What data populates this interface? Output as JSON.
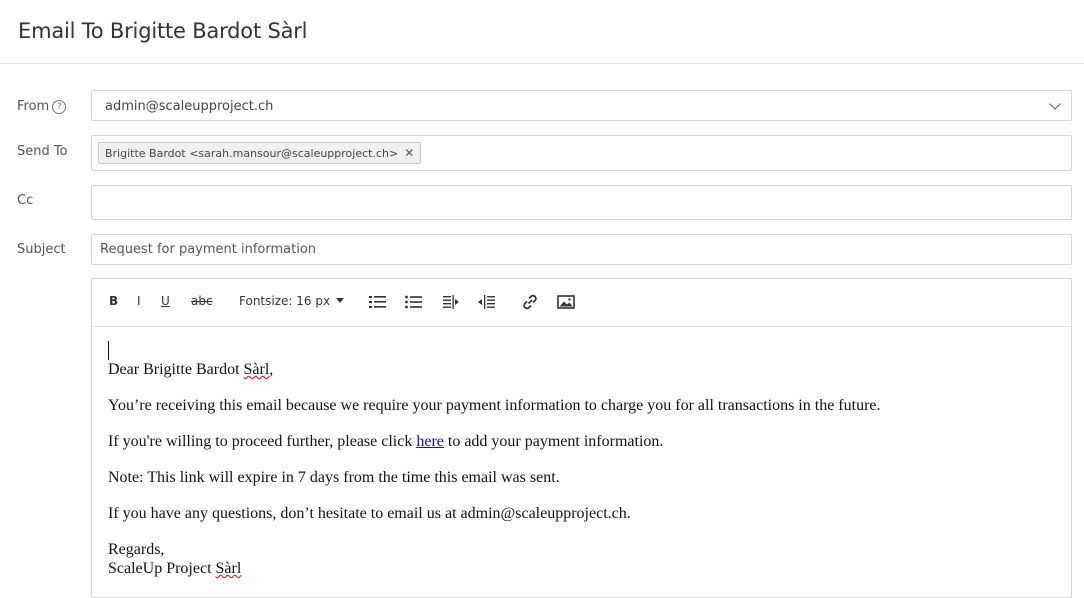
{
  "header": {
    "title": "Email To Brigitte Bardot Sàrl"
  },
  "form": {
    "from_label": "From",
    "from_value": "admin@scaleupproject.ch",
    "send_to_label": "Send To",
    "recipient_chip": "Brigitte Bardot <sarah.mansour@scaleupproject.ch>",
    "cc_label": "Cc",
    "cc_value": "",
    "subject_label": "Subject",
    "subject_value": "Request for payment information"
  },
  "toolbar": {
    "bold": "B",
    "italic": "I",
    "underline": "U",
    "strike": "abc",
    "fontsize": "Fontsize: 16 px",
    "icons": [
      "ordered-list-icon",
      "unordered-list-icon",
      "indent-icon",
      "outdent-icon",
      "link-icon",
      "image-icon"
    ]
  },
  "message": {
    "greeting_prefix": "Dear Brigitte Bardot ",
    "greeting_name": "Sàrl",
    "greeting_suffix": ",",
    "line1": "You’re receiving this email because we require your payment information to charge you for all transactions in the future.",
    "line2_prefix": "If you're willing to proceed further, please click ",
    "line2_link": "here",
    "line2_suffix": " to add your payment information.",
    "line3": "Note: This link will expire in 7 days from the time this email was sent.",
    "line4": "If you have any questions, don’t hesitate to email us at admin@scaleupproject.ch.",
    "regards": "Regards,",
    "signature_prefix": "ScaleUp Project ",
    "signature_name": "Sàrl"
  },
  "colors": {
    "link": "#1a0dab",
    "border": "#d5d5d5",
    "text": "#333333"
  }
}
